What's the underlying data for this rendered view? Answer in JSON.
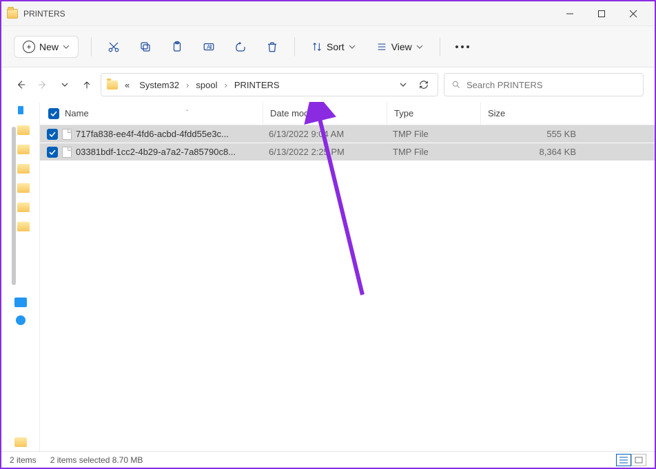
{
  "window": {
    "title": "PRINTERS"
  },
  "toolbar": {
    "new_label": "New",
    "sort_label": "Sort",
    "view_label": "View"
  },
  "breadcrumbs": {
    "prefix": "«",
    "items": [
      "System32",
      "spool",
      "PRINTERS"
    ]
  },
  "search": {
    "placeholder": "Search PRINTERS"
  },
  "columns": {
    "name": "Name",
    "date": "Date modified",
    "type": "Type",
    "size": "Size"
  },
  "files": [
    {
      "name": "717fa838-ee4f-4fd6-acbd-4fdd55e3c...",
      "date": "6/13/2022 9:04 AM",
      "type": "TMP File",
      "size": "555 KB"
    },
    {
      "name": "03381bdf-1cc2-4b29-a7a2-7a85790c8...",
      "date": "6/13/2022 2:25 PM",
      "type": "TMP File",
      "size": "8,364 KB"
    }
  ],
  "status": {
    "count": "2 items",
    "selection": "2 items selected  8.70 MB"
  }
}
